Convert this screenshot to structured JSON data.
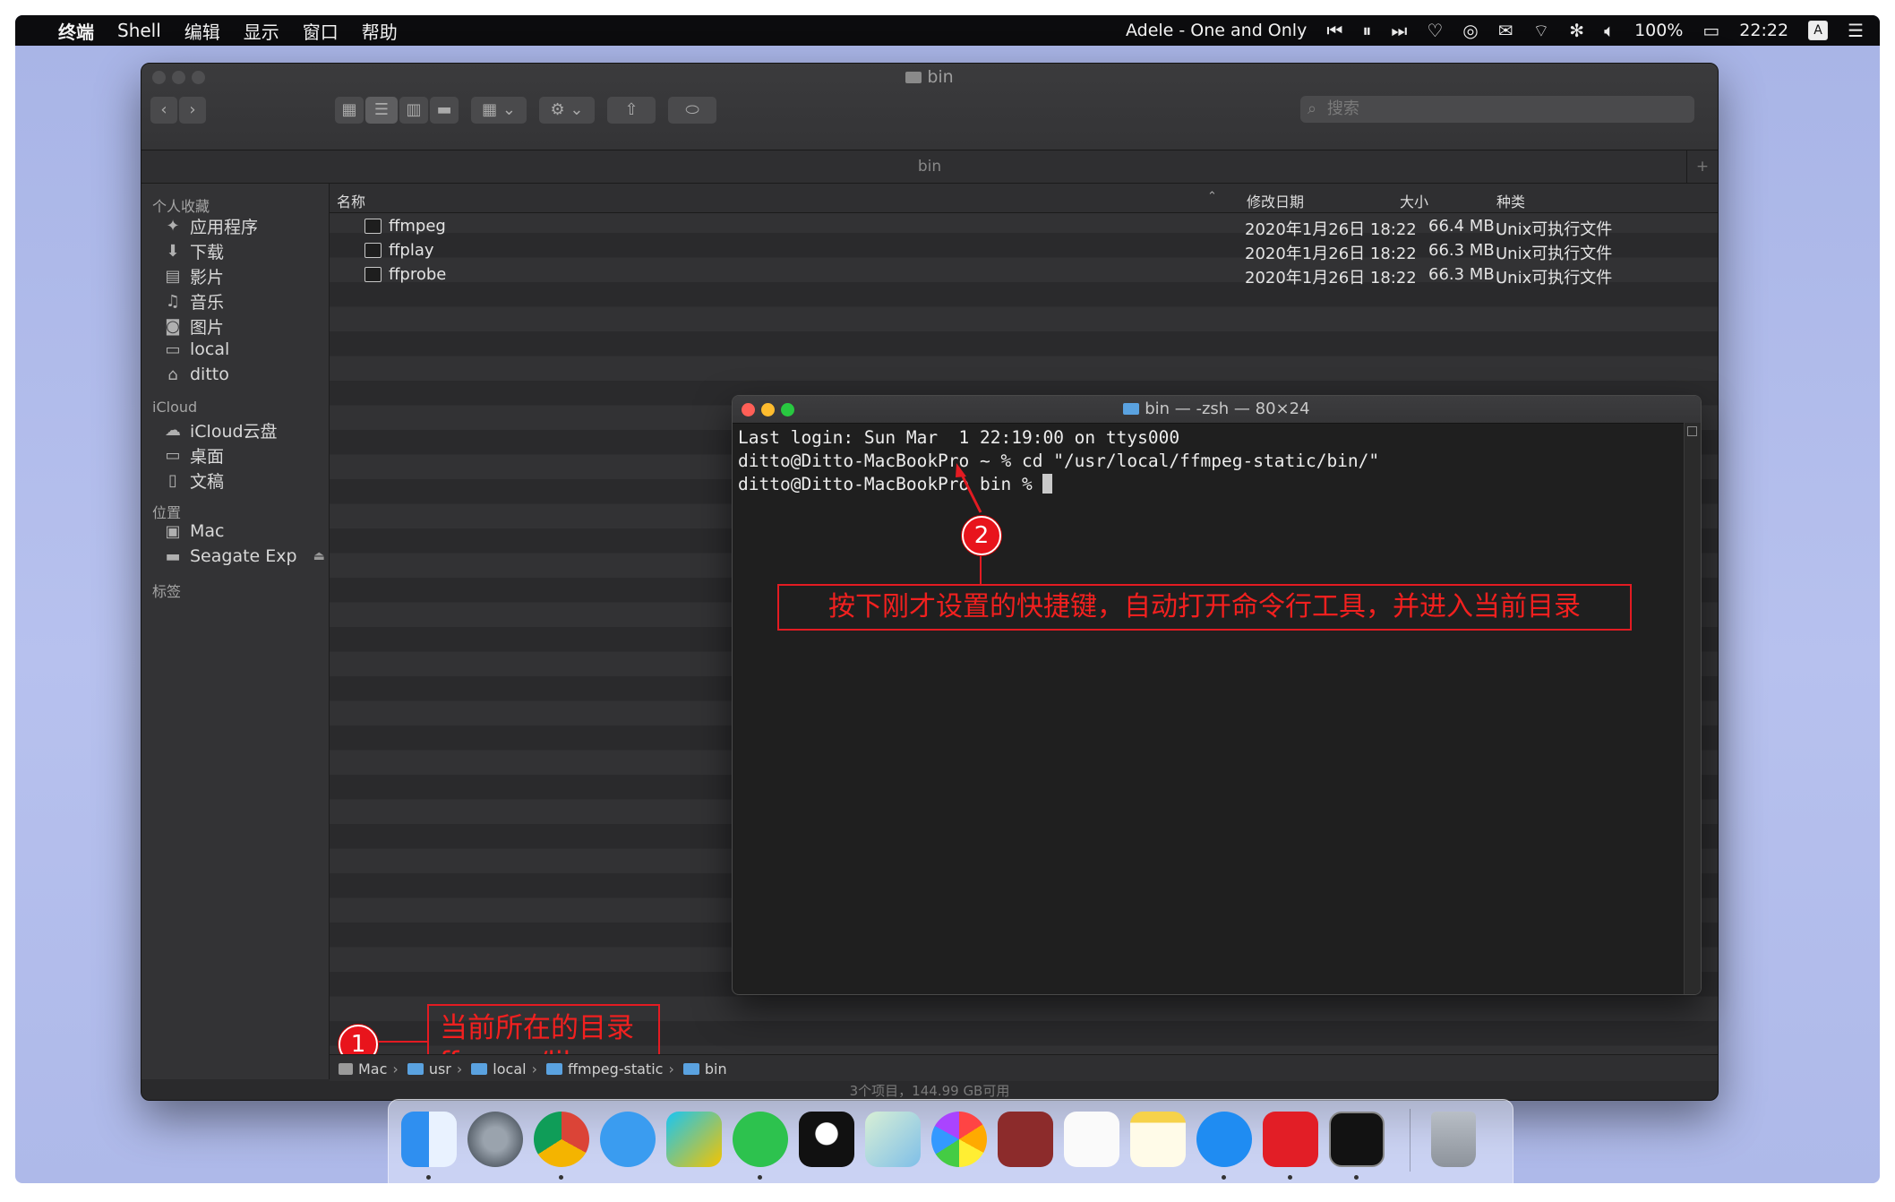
{
  "menubar": {
    "apple": "",
    "items": [
      "终端",
      "Shell",
      "编辑",
      "显示",
      "窗口",
      "帮助"
    ],
    "now_playing": "Adele - One and Only",
    "battery": "100%",
    "clock": "22:22",
    "input_method": "A"
  },
  "finder": {
    "title": "bin",
    "search_placeholder": "搜索",
    "path_title": "bin",
    "sidebar": {
      "favorites_header": "个人收藏",
      "favorites": [
        "应用程序",
        "下载",
        "影片",
        "音乐",
        "图片",
        "local",
        "ditto"
      ],
      "icloud_header": "iCloud",
      "icloud": [
        "iCloud云盘",
        "桌面",
        "文稿"
      ],
      "locations_header": "位置",
      "locations": [
        "Mac",
        "Seagate Exp"
      ],
      "tags_header": "标签"
    },
    "columns": {
      "name": "名称",
      "date": "修改日期",
      "size": "大小",
      "kind": "种类"
    },
    "files": [
      {
        "name": "ffmpeg",
        "date": "2020年1月26日 18:22",
        "size": "66.4 MB",
        "kind": "Unix可执行文件"
      },
      {
        "name": "ffplay",
        "date": "2020年1月26日 18:22",
        "size": "66.3 MB",
        "kind": "Unix可执行文件"
      },
      {
        "name": "ffprobe",
        "date": "2020年1月26日 18:22",
        "size": "66.3 MB",
        "kind": "Unix可执行文件"
      }
    ],
    "breadcrumb": [
      "Mac",
      "usr",
      "local",
      "ffmpeg-static",
      "bin"
    ],
    "status": "3个项目，144.99 GB可用"
  },
  "terminal": {
    "title": "bin — -zsh — 80×24",
    "lines": [
      "Last login: Sun Mar  1 22:19:00 on ttys000",
      "ditto@Ditto-MacBookPro ~ % cd \"/usr/local/ffmpeg-static/bin/\"",
      "ditto@Ditto-MacBookPro bin % "
    ]
  },
  "annotations": {
    "one_number": "1",
    "one_line1": "当前所在的目录",
    "one_line2": "ffmpeg/lib",
    "two_number": "2",
    "two_text": "按下刚才设置的快捷键，自动打开命令行工具，并进入当前目录"
  },
  "colors": {
    "annotation_red": "#e31b22",
    "finder_bg": "#2a2a2c",
    "terminal_bg": "#1f1f1f"
  },
  "dock": [
    "finder-icon",
    "launchpad-icon",
    "chrome-icon",
    "messages-icon",
    "infuse-icon",
    "wechat-icon",
    "qq-icon",
    "maps-icon",
    "photos-icon",
    "dictionary-icon",
    "reminders-icon",
    "notes-icon",
    "app-store-icon",
    "netease-music-icon",
    "terminal-icon",
    "trash-icon"
  ]
}
